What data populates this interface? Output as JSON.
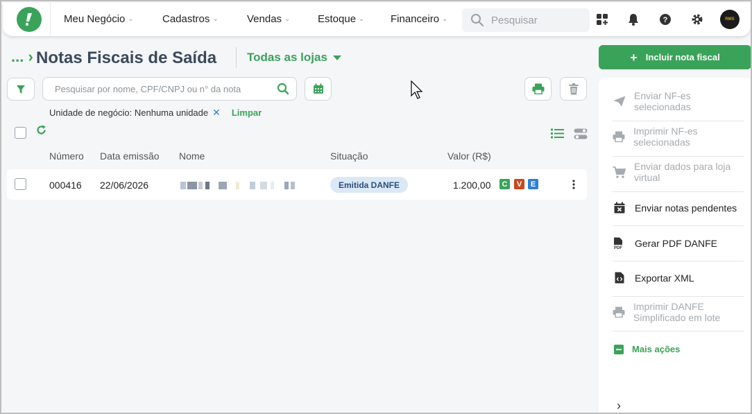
{
  "nav": {
    "items": [
      {
        "label": "Meu Negócio"
      },
      {
        "label": "Cadastros"
      },
      {
        "label": "Vendas"
      },
      {
        "label": "Estoque"
      },
      {
        "label": "Financeiro"
      }
    ],
    "search_placeholder": "Pesquisar",
    "avatar_text": "RMS"
  },
  "header": {
    "breadcrumb": "...",
    "title": "Notas Fiscais de Saída",
    "store_filter": "Todas as lojas"
  },
  "filters": {
    "search_placeholder": "Pesquisar por nome, CPF/CNPJ ou n° da nota",
    "active_filter": "Unidade de negócio: Nenhuma unidade",
    "clear_label": "Limpar"
  },
  "table": {
    "columns": [
      "Número",
      "Data emissão",
      "Nome",
      "Situação",
      "Valor (R$)"
    ],
    "rows": [
      {
        "numero": "000416",
        "data": "22/06/2026",
        "situacao": "Emitida DANFE",
        "valor": "1.200,00",
        "tags": [
          "C",
          "V",
          "E"
        ]
      }
    ]
  },
  "sidebar": {
    "cta": "Incluir nota fiscal",
    "actions": [
      {
        "label": "Enviar NF-es selecionadas",
        "enabled": false,
        "icon": "send-icon"
      },
      {
        "label": "Imprimir NF-es selecionadas",
        "enabled": false,
        "icon": "printer-icon"
      },
      {
        "label": "Enviar dados para loja virtual",
        "enabled": false,
        "icon": "cart-icon"
      },
      {
        "label": "Enviar notas pendentes",
        "enabled": true,
        "icon": "calendar-x-icon"
      },
      {
        "label": "Gerar PDF DANFE",
        "enabled": true,
        "icon": "pdf-icon"
      },
      {
        "label": "Exportar XML",
        "enabled": true,
        "icon": "code-file-icon"
      },
      {
        "label": "Imprimir DANFE Simplificado em lote",
        "enabled": false,
        "icon": "printer-icon"
      }
    ],
    "more": "Mais ações"
  },
  "colors": {
    "brand_green": "#3aa35a",
    "title_slate": "#3b4a5a",
    "badge_bg": "#dbe8f6",
    "tag_c": "#3aa35a",
    "tag_v": "#c94a1e",
    "tag_e": "#2f7fd6"
  }
}
